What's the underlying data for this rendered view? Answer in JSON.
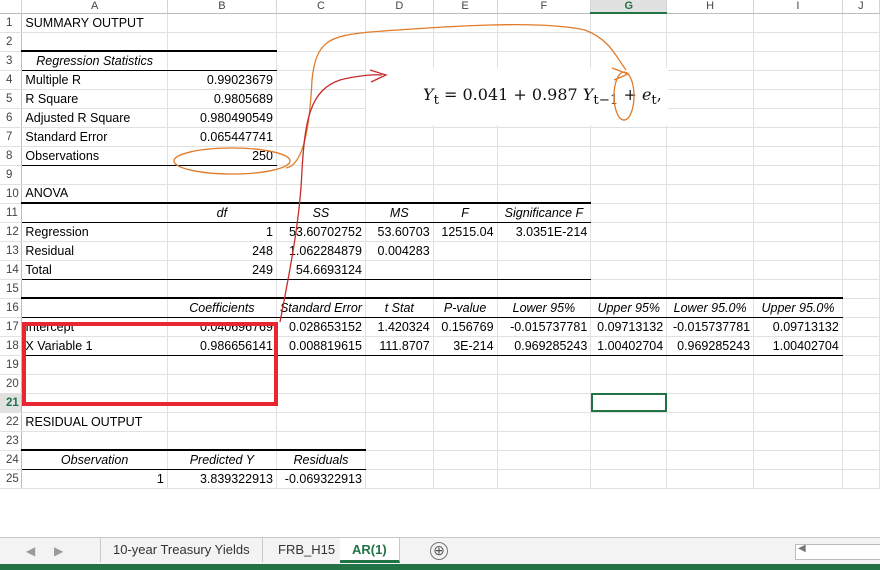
{
  "columns": [
    "A",
    "B",
    "C",
    "D",
    "E",
    "F",
    "G",
    "H",
    "I",
    "J"
  ],
  "selected_column": "G",
  "selected_row": "21",
  "rows": [
    {
      "n": "1",
      "A": "SUMMARY OUTPUT"
    },
    {
      "n": "2"
    },
    {
      "n": "3",
      "A": "Regression Statistics"
    },
    {
      "n": "4",
      "A": "Multiple R",
      "B": "0.99023679"
    },
    {
      "n": "5",
      "A": "R Square",
      "B": "0.9805689"
    },
    {
      "n": "6",
      "A": "Adjusted R Square",
      "B": "0.980490549"
    },
    {
      "n": "7",
      "A": "Standard Error",
      "B": "0.065447741"
    },
    {
      "n": "8",
      "A": "Observations",
      "B": "250"
    },
    {
      "n": "9"
    },
    {
      "n": "10",
      "A": "ANOVA"
    },
    {
      "n": "11",
      "B": "df",
      "C": "SS",
      "D": "MS",
      "E": "F",
      "F": "Significance F"
    },
    {
      "n": "12",
      "A": "Regression",
      "B": "1",
      "C": "53.60702752",
      "D": "53.60703",
      "E": "12515.04",
      "F": "3.0351E-214"
    },
    {
      "n": "13",
      "A": "Residual",
      "B": "248",
      "C": "1.062284879",
      "D": "0.004283"
    },
    {
      "n": "14",
      "A": "Total",
      "B": "249",
      "C": "54.6693124"
    },
    {
      "n": "15"
    },
    {
      "n": "16",
      "B": "Coefficients",
      "C": "Standard Error",
      "D": "t Stat",
      "E": "P-value",
      "F": "Lower 95%",
      "G": "Upper 95%",
      "H": "Lower 95.0%",
      "I": "Upper 95.0%"
    },
    {
      "n": "17",
      "A": "Intercept",
      "B": "0.040696769",
      "C": "0.028653152",
      "D": "1.420324",
      "E": "0.156769",
      "F": "-0.015737781",
      "G": "0.09713132",
      "H": "-0.015737781",
      "I": "0.09713132"
    },
    {
      "n": "18",
      "A": "X Variable 1",
      "B": "0.986656141",
      "C": "0.008819615",
      "D": "111.8707",
      "E": "3E-214",
      "F": "0.969285243",
      "G": "1.00402704",
      "H": "0.969285243",
      "I": "1.00402704"
    },
    {
      "n": "19"
    },
    {
      "n": "20"
    },
    {
      "n": "21"
    },
    {
      "n": "22",
      "A": "RESIDUAL OUTPUT"
    },
    {
      "n": "23"
    },
    {
      "n": "24",
      "A": "Observation",
      "B": "Predicted Y",
      "C": "Residuals"
    },
    {
      "n": "25",
      "A": "1",
      "B": "3.839322913",
      "C": "-0.069322913"
    }
  ],
  "equation": {
    "lhs": "Y",
    "lhs_sub": "t",
    "eq": " = 0.041 + 0.987 ",
    "y2": "Y",
    "y2_sub": "t−1",
    "plus": " + ",
    "e": "e",
    "e_sub": "t",
    "tail": ","
  },
  "annotation_colors": {
    "orange": "#e07b2a",
    "red_arrow": "#c62b2b",
    "red_box": "#e8262f"
  },
  "sheet_tabs": [
    "10-year Treasury Yields",
    "FRB_H15",
    "AR(1)"
  ],
  "active_tab": "AR(1)",
  "icons": {
    "add_sheet": "⊕",
    "prev_tab": "◀",
    "next_tab": "▶"
  }
}
